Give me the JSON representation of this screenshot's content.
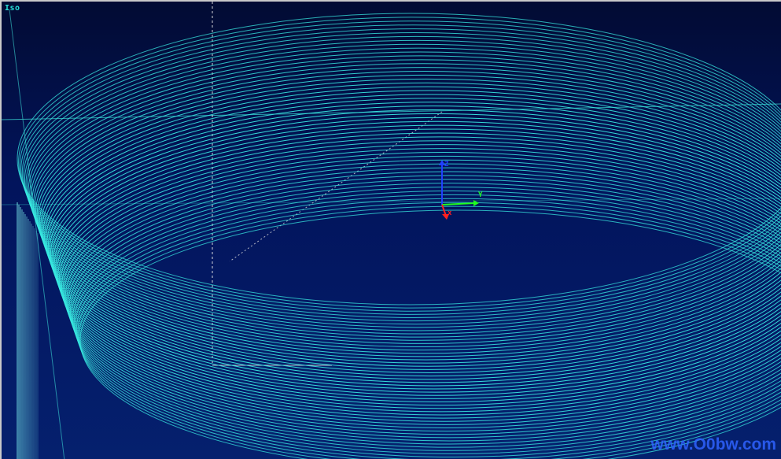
{
  "viewport": {
    "view_label": "Iso",
    "background_color": "#02145c",
    "wire_color": "#38e8e0",
    "coil_turn_count": 52
  },
  "triad": {
    "x_label": "x",
    "y_label": "Y",
    "z_label": "Z",
    "x_color": "#ff2020",
    "y_color": "#20ff20",
    "z_color": "#2040ff"
  },
  "watermark": {
    "text": "www.O0bw.com",
    "color": "#2f63ff"
  }
}
